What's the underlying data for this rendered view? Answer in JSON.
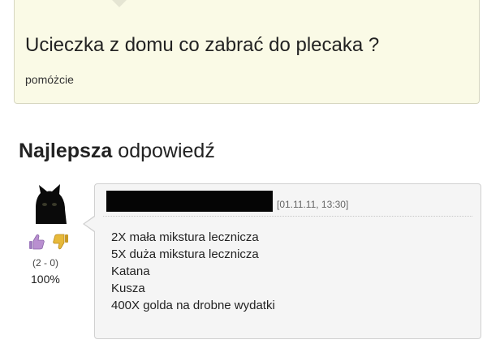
{
  "question": {
    "title": "Ucieczka z domu co zabrać do plecaka ?",
    "details": "pomóżcie"
  },
  "best_answer": {
    "heading_bold": "Najlepsza",
    "heading_rest": "odpowiedź",
    "author": {
      "avatar_icon": "black-cat-avatar-icon",
      "name_redacted": true
    },
    "votes": {
      "up_icon": "thumbs-up-icon",
      "down_icon": "thumbs-down-icon",
      "count": "(2 - 0)",
      "percent": "100%"
    },
    "date": "[01.11.11, 13:30]",
    "lines": [
      "2X mała mikstura lecznicza",
      "5X duża mikstura lecznicza",
      "Katana",
      "Kusza",
      "400X golda na drobne wydatki"
    ]
  },
  "colors": {
    "question_bg": "#fafae6",
    "answer_bg": "#f5f5f5",
    "thumb_up": "#b98fd0",
    "thumb_down": "#e7b93a"
  }
}
